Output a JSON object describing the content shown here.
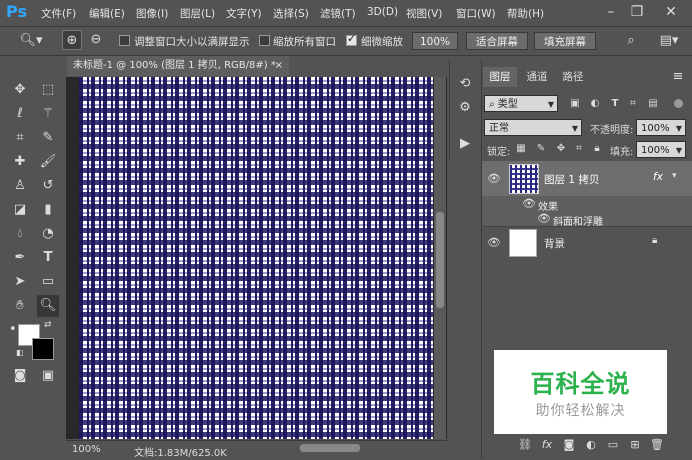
{
  "app": {
    "logo": "Ps"
  },
  "menu": [
    "文件(F)",
    "编辑(E)",
    "图像(I)",
    "图层(L)",
    "文字(Y)",
    "选择(S)",
    "滤镜(T)",
    "3D(D)",
    "视图(V)",
    "窗口(W)",
    "帮助(H)"
  ],
  "window_controls": {
    "minimize": "–",
    "restore": "❐",
    "close": "✕"
  },
  "options": {
    "resize_windows_label": "调整窗口大小以满屏显示",
    "resize_windows_checked": false,
    "zoom_all_label": "缩放所有窗口",
    "zoom_all_checked": false,
    "scrubby_zoom_label": "细微缩放",
    "scrubby_zoom_checked": true,
    "zoom_value": "100%",
    "fit_screen": "适合屏幕",
    "fill_screen": "填充屏幕"
  },
  "document": {
    "tab_title": "未标题-1 @ 100% (图层 1 拷贝, RGB/8#) *",
    "close": "×",
    "status_zoom": "100%",
    "status_doc": "文档:1.83M/625.0K"
  },
  "panels": {
    "tabs": [
      "图层",
      "通道",
      "路径"
    ],
    "active_tab": "图层",
    "filter_kind": "类型",
    "blend_mode": "正常",
    "opacity_label": "不透明度:",
    "opacity_value": "100%",
    "lock_label": "锁定:",
    "fill_label": "填充:",
    "fill_value": "100%"
  },
  "layers": [
    {
      "name": "图层 1 拷贝",
      "fx": "fx",
      "selected": true
    },
    {
      "name": "效果",
      "sub": true
    },
    {
      "name": "斜面和浮雕",
      "sub2": true
    },
    {
      "name": "背景",
      "locked": true
    }
  ],
  "watermark": {
    "title": "百科全说",
    "subtitle": "助你轻松解决"
  },
  "colors": {
    "accent": "#31a8ff",
    "watermark_green": "#2bb24c",
    "panel_bg": "#535353"
  }
}
